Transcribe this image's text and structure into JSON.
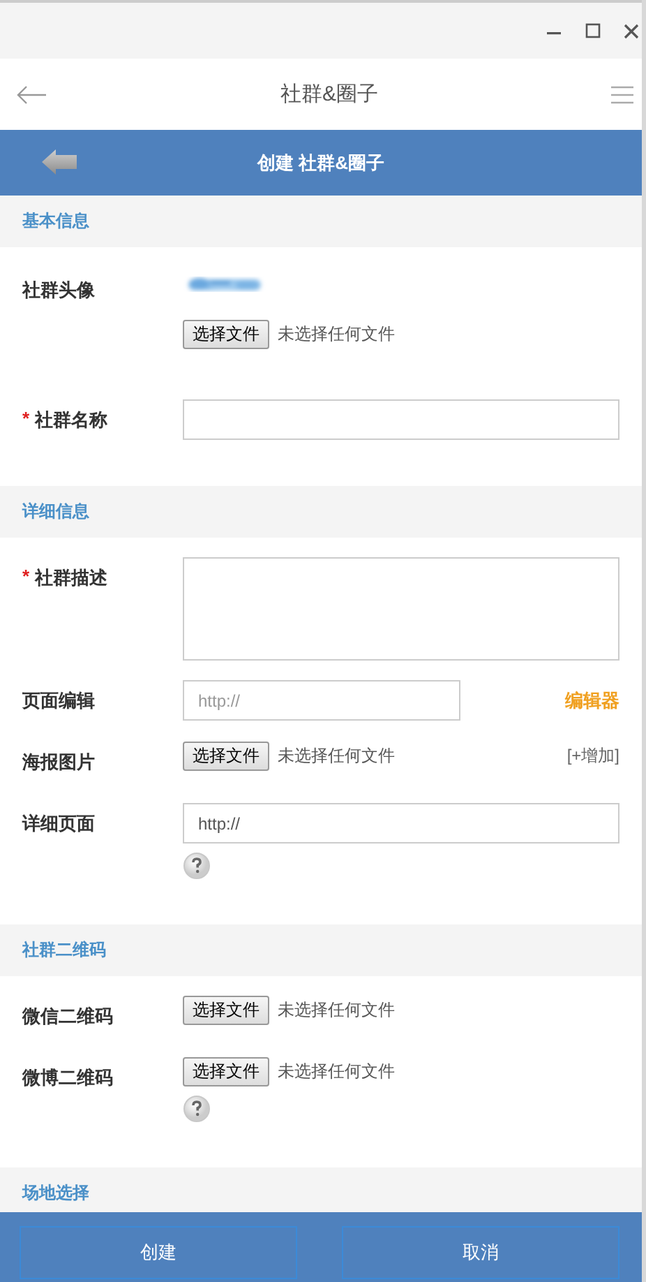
{
  "nav": {
    "title": "社群&圈子"
  },
  "header": {
    "title": "创建 社群&圈子"
  },
  "sections": [
    {
      "title": "基本信息",
      "rows": [
        {
          "label": "社群头像",
          "button": "选择文件",
          "status": "未选择任何文件"
        },
        {
          "kind": "input",
          "label": "社群名称",
          "mark": "*"
        }
      ]
    },
    {
      "title": "详细信息",
      "rows": [
        {
          "kind": "textarea",
          "label": "社群描述",
          "mark": "*"
        },
        {
          "kind": "link-input",
          "label": "页面编辑",
          "placeholder": "http://",
          "link": "编辑器"
        },
        {
          "kind": "file",
          "label": "海报图片",
          "button": "选择文件",
          "status": "未选择任何文件",
          "extra": "[+增加]"
        },
        {
          "kind": "input",
          "label": "详细页面",
          "value": "http://",
          "help": true
        }
      ]
    },
    {
      "title": "社群二维码",
      "rows": [
        {
          "kind": "file",
          "label": "微信二维码",
          "button": "选择文件",
          "status": "未选择任何文件"
        },
        {
          "kind": "file",
          "label": "微博二维码",
          "button": "选择文件",
          "status": "未选择任何文件",
          "help": true
        }
      ]
    },
    {
      "title": "场地选择"
    }
  ],
  "footer": {
    "buttons": [
      "创建",
      "取消"
    ]
  }
}
